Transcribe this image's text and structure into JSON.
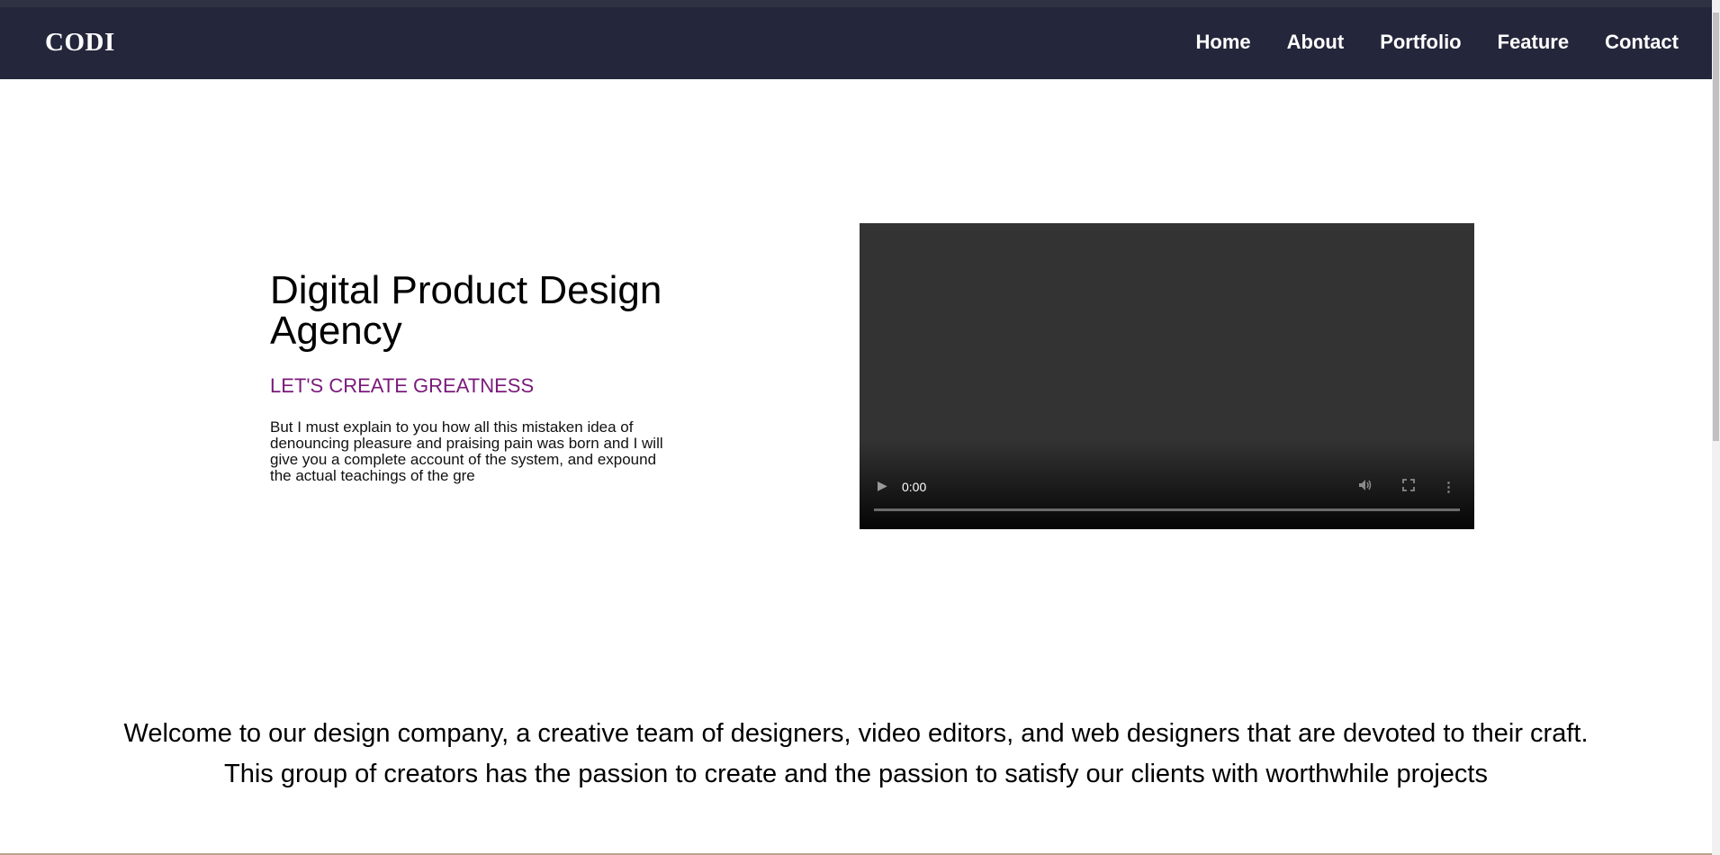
{
  "brand": {
    "logo_text": "CODI"
  },
  "nav": {
    "links": [
      "Home",
      "About",
      "Portfolio",
      "Feature",
      "Contact"
    ]
  },
  "hero": {
    "title": "Digital Product Design Agency",
    "subtitle": "LET'S CREATE GREATNESS",
    "description": "But I must explain to you how all this mistaken idea of denouncing pleasure and praising pain was born and I will give you a complete account of the system, and expound the actual teachings of the gre"
  },
  "video": {
    "time": "0:00"
  },
  "welcome": {
    "text": "Welcome to our design company, a creative team of designers, video editors, and web designers that are devoted to their craft. This group of creators has the passion to create and the passion to satisfy our clients with worthwhile projects"
  },
  "colors": {
    "navbar_bg": "#24273b",
    "subtitle_accent": "#7b1a7b",
    "video_bg": "#333333"
  },
  "icons": [
    "play-icon",
    "volume-icon",
    "fullscreen-icon",
    "more-options-icon"
  ]
}
